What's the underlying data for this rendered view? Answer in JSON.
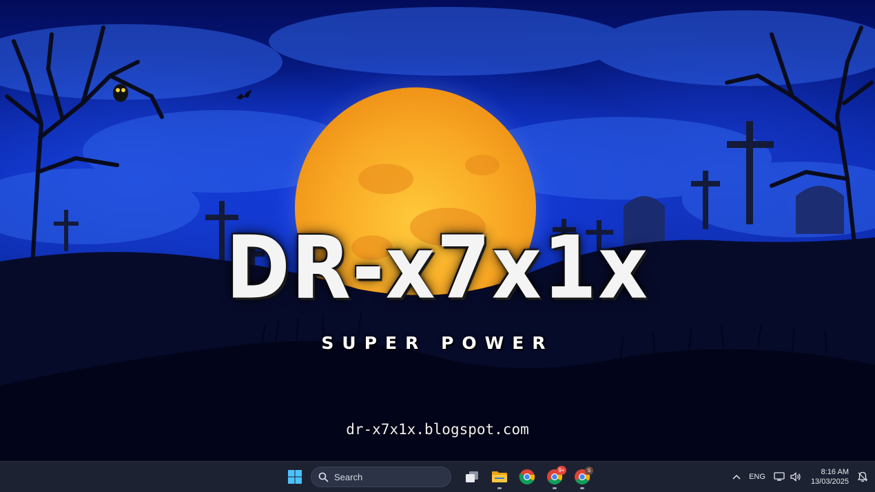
{
  "wallpaper": {
    "logo": "DR-x7x1x",
    "tagline": "SUPER POWER",
    "url": "dr-x7x1x.blogspot.com",
    "colors": {
      "sky": "#0a2cb8",
      "moon": "#f7a623",
      "ground": "#01051c"
    }
  },
  "taskbar": {
    "start_icon": "windows-logo-icon",
    "search": {
      "label": "Search",
      "icon": "search-icon"
    },
    "apps": [
      {
        "name": "task-view",
        "icon": "task-view-icon"
      },
      {
        "name": "file-explorer",
        "icon": "folder-icon"
      },
      {
        "name": "chrome",
        "icon": "chrome-icon"
      },
      {
        "name": "chrome-profile-2",
        "icon": "chrome-icon",
        "badge": "9+"
      },
      {
        "name": "chrome-profile-3",
        "icon": "chrome-icon",
        "profile": "S"
      }
    ],
    "tray": {
      "overflow_icon": "chevron-up-icon",
      "language": "ENG",
      "network_icon": "network-icon",
      "volume_icon": "speaker-icon",
      "notification_icon": "notification-bell-icon"
    },
    "clock": {
      "time": "8:16 AM",
      "date": "13/03/2025"
    }
  }
}
